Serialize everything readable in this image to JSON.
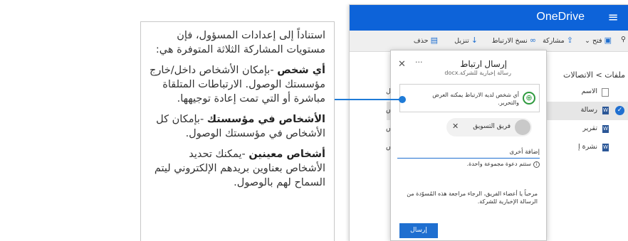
{
  "callout": {
    "intro": "استناداً إلى إعدادات المسؤول، فإن مستويات المشاركة الثلاثة المتوفرة هي:",
    "items": [
      {
        "title": "أي شخص",
        "desc": " -بإمكان الأشخاص داخل/خارج مؤسستك الوصول. الارتباطات المتلقاة مباشرة أو التي تمت إعادة توجيهها."
      },
      {
        "title": "الأشخاص في مؤسستك",
        "desc": " -بإمكان كل الأشخاص في مؤسستك الوصول."
      },
      {
        "title": "أشخاص معينين",
        "desc": " -يمكنك تحديد الأشخاص بعناوين بريدهم الإلكتروني ليتم السماح لهم بالوصول."
      }
    ]
  },
  "app": {
    "title": "OneDrive"
  },
  "toolbar": {
    "open": "فتح",
    "share": "مشاركة",
    "copy_link": "نسخ الارتباط",
    "download": "تنزيل",
    "delete": "حذف"
  },
  "breadcrumb": {
    "root": "ملفات",
    "separator": ">",
    "current": "الاتصالات"
  },
  "list": {
    "header_name": "الاسم",
    "header_modified": "عديل",
    "rows": [
      {
        "name": "رسالة",
        "modified": "طس"
      },
      {
        "name": "تقرير",
        "modified": "طس"
      },
      {
        "name": "نشرة إ",
        "modified": "طس"
      }
    ]
  },
  "dialog": {
    "title": "إرسال ارتباط",
    "subtitle": "رسالة إخبارية للشركة.docx",
    "permission": "أي شخص لديه الارتباط يمكنه العرض والتحرير.",
    "recipient": "فريق التسويق",
    "add_more": "إضافة أخرى",
    "info": "ستتم دعوة مجموعة واحدة.",
    "message": "مرحباً يا أعضاء الفريق، الرجاء مراجعة هذه المُسوّدة من الرسالة الإخبارية للشركة.",
    "send": "إرسال"
  },
  "colors": {
    "brand": "#0d63d9",
    "accent": "#1f7bd7",
    "globe": "#2e9a3e"
  }
}
